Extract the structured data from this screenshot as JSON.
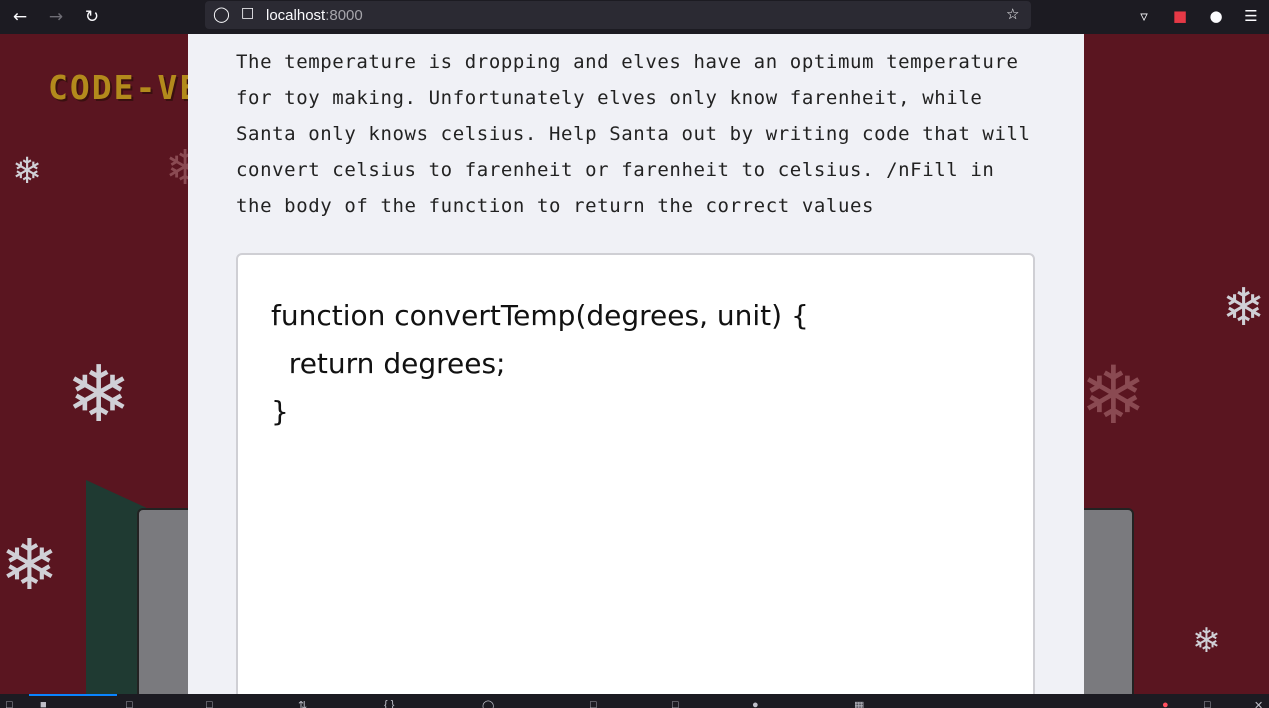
{
  "browser": {
    "url_host": "localhost",
    "url_port": ":8000",
    "icons": [
      "back-arrow-icon",
      "forward-arrow-icon",
      "reload-icon",
      "shield-icon",
      "page-icon",
      "star-icon",
      "pocket-icon",
      "extension-icon",
      "profile-icon",
      "menu-icon"
    ]
  },
  "page": {
    "logo": "CODE-VE",
    "prompt_text": "The temperature is dropping and elves have an optimum temperature for toy making. Unfortunately elves only know farenheit, while Santa only knows celsius. Help Santa out by writing code that will convert celsius to farenheit or farenheit to celsius. /nFill in the body of the function to return the correct values",
    "code_lines": [
      "function convertTemp(degrees, unit) {",
      "  return degrees;",
      "}"
    ]
  },
  "colors": {
    "background": "#5a1520",
    "modal": "#f0f1f6",
    "logo": "#b38a1c"
  }
}
